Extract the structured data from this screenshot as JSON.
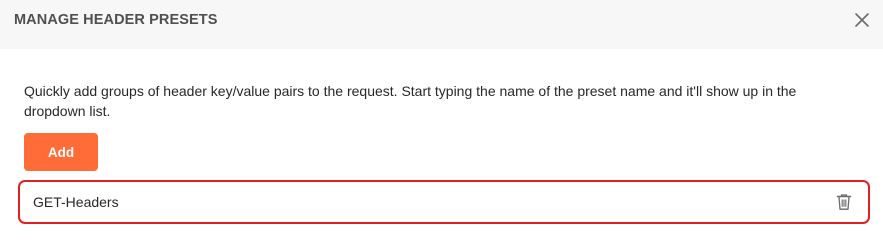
{
  "modal": {
    "title": "MANAGE HEADER PRESETS",
    "close_icon": "close-icon",
    "description": "Quickly add groups of header key/value pairs to the request. Start typing the name of the preset name and it'll show up in the dropdown list.",
    "add_label": "Add",
    "presets": [
      {
        "name": "GET-Headers",
        "action_icon": "trash-icon"
      }
    ]
  },
  "colors": {
    "accent": "#ff6c37",
    "header_bg": "#f7f7f7",
    "highlight_border": "#e41f1f",
    "text": "#282828"
  }
}
